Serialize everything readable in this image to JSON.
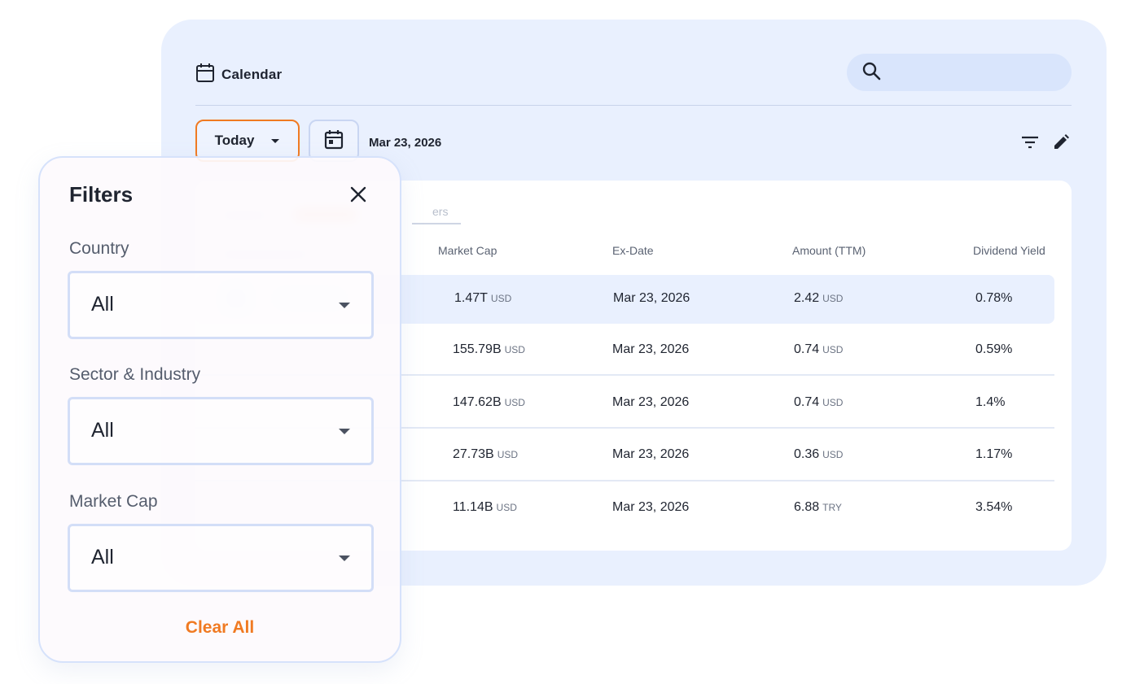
{
  "calendar": {
    "title": "Calendar"
  },
  "search": {
    "placeholder": ""
  },
  "toolbar": {
    "period_label": "Today",
    "date": "Mar 23, 2026"
  },
  "table": {
    "tab_partial": "ers",
    "headers": {
      "market_cap": "Market Cap",
      "ex_date": "Ex-Date",
      "amount": "Amount (TTM)",
      "yield": "Dividend Yield"
    },
    "rows": [
      {
        "market_cap": "1.47T",
        "market_cap_unit": "USD",
        "ex_date": "Mar 23, 2026",
        "amount": "2.42",
        "amount_unit": "USD",
        "yield": "0.78%"
      },
      {
        "market_cap": "155.79B",
        "market_cap_unit": "USD",
        "ex_date": "Mar 23, 2026",
        "amount": "0.74",
        "amount_unit": "USD",
        "yield": "0.59%"
      },
      {
        "market_cap": "147.62B",
        "market_cap_unit": "USD",
        "ex_date": "Mar 23, 2026",
        "amount": "0.74",
        "amount_unit": "USD",
        "yield": "1.4%"
      },
      {
        "market_cap": "27.73B",
        "market_cap_unit": "USD",
        "ex_date": "Mar 23, 2026",
        "amount": "0.36",
        "amount_unit": "USD",
        "yield": "1.17%"
      },
      {
        "market_cap": "11.14B",
        "market_cap_unit": "USD",
        "ex_date": "Mar 23, 2026",
        "amount": "6.88",
        "amount_unit": "TRY",
        "yield": "3.54%"
      }
    ]
  },
  "filters": {
    "title": "Filters",
    "country": {
      "label": "Country",
      "value": "All"
    },
    "sector": {
      "label": "Sector & Industry",
      "value": "All"
    },
    "market_cap": {
      "label": "Market Cap",
      "value": "All"
    },
    "clear_all": "Clear All"
  },
  "colors": {
    "accent": "#f07a22",
    "panel_bg": "#e9f0fe",
    "search_bg": "#d9e5fc"
  },
  "icons": [
    "calendar-icon",
    "search-icon",
    "chevron-down-icon",
    "date-picker-icon",
    "filter-icon",
    "edit-icon",
    "close-icon"
  ]
}
